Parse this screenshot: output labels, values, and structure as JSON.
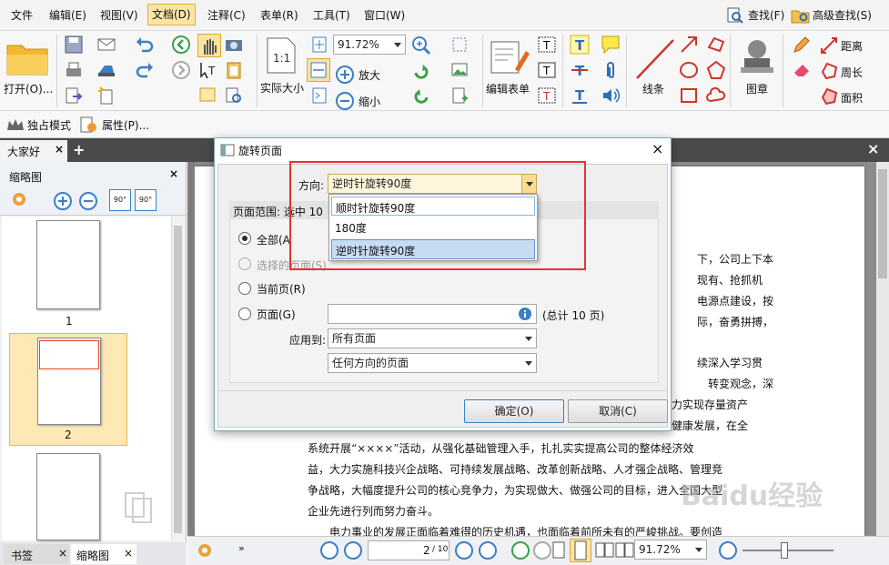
{
  "menubar": {
    "items": [
      "文件",
      "编辑(E)",
      "视图(V)",
      "文档(D)",
      "注释(C)",
      "表单(R)",
      "工具(T)",
      "窗口(W)"
    ],
    "right": [
      "查找(F)",
      "高级查找(S)"
    ]
  },
  "ribbon": {
    "open_label": "打开(O)...",
    "zoom_value": "91.72%",
    "actual_size": "实际大小",
    "zoom_in": "放大",
    "zoom_out": "缩小",
    "edit_form": "编辑表单",
    "lines": "线条",
    "stamp": "图章",
    "distance": "距离",
    "perimeter": "周长",
    "area": "面积",
    "exclusive_mode": "独占模式",
    "properties": "属性(P)..."
  },
  "tabs": {
    "doc_tab": "大家好"
  },
  "leftpanel": {
    "title": "缩略图",
    "rotate_ccw": "90°",
    "rotate_cw": "90°",
    "thumbs": [
      "1",
      "2"
    ],
    "bottom_tabs": [
      "书签",
      "缩略图"
    ]
  },
  "dialog": {
    "title": "旋转页面",
    "direction_label": "方向:",
    "direction_value": "逆时针旋转90度",
    "dropdown_options": [
      "顺时针旋转90度",
      "180度",
      "逆时针旋转90度"
    ],
    "range_title": "页面范围: 选中 10",
    "radio_all": "全部(A",
    "radio_selected": "选择的页面(S)",
    "radio_current": "当前页(R)",
    "radio_pages": "页面(G)",
    "pages_total": "(总计 10 页)",
    "pages_total_num": "10",
    "apply_to_label": "应用到:",
    "apply_to_value": "所有页面",
    "orientation_value": "任何方向的页面",
    "ok": "确定(O)",
    "cancel": "取消(C)"
  },
  "document": {
    "lines": [
      "下，公司上下本",
      "现有、抢抓机",
      "电源点建设，按",
      "际，奋勇拼搏，",
      "续深入学习贯",
      "转变观念，深",
      "力实现存量资产",
      "健康发展，在全",
      "系统开展“××××”活动，从强化基础管理入手，扎扎实实提高公司的整体经济效",
      "益，大力实施科技兴企战略、可持续发展战略、改革创新战略、人才强企战略、管理竞",
      "争战略，大幅度提升公司的核心竞争力，为实现做大、做强公司的目标，进入全国大型",
      "企业先进行列而努力奋斗。",
      "电力事业的发展正面临着难得的历史机遇，也面临着前所未有的严峻挑战。要创造"
    ]
  },
  "statusbar": {
    "page_current": "2",
    "page_total": "/ 10",
    "zoom_value": "91.72%"
  },
  "watermark": "Baidu经验"
}
